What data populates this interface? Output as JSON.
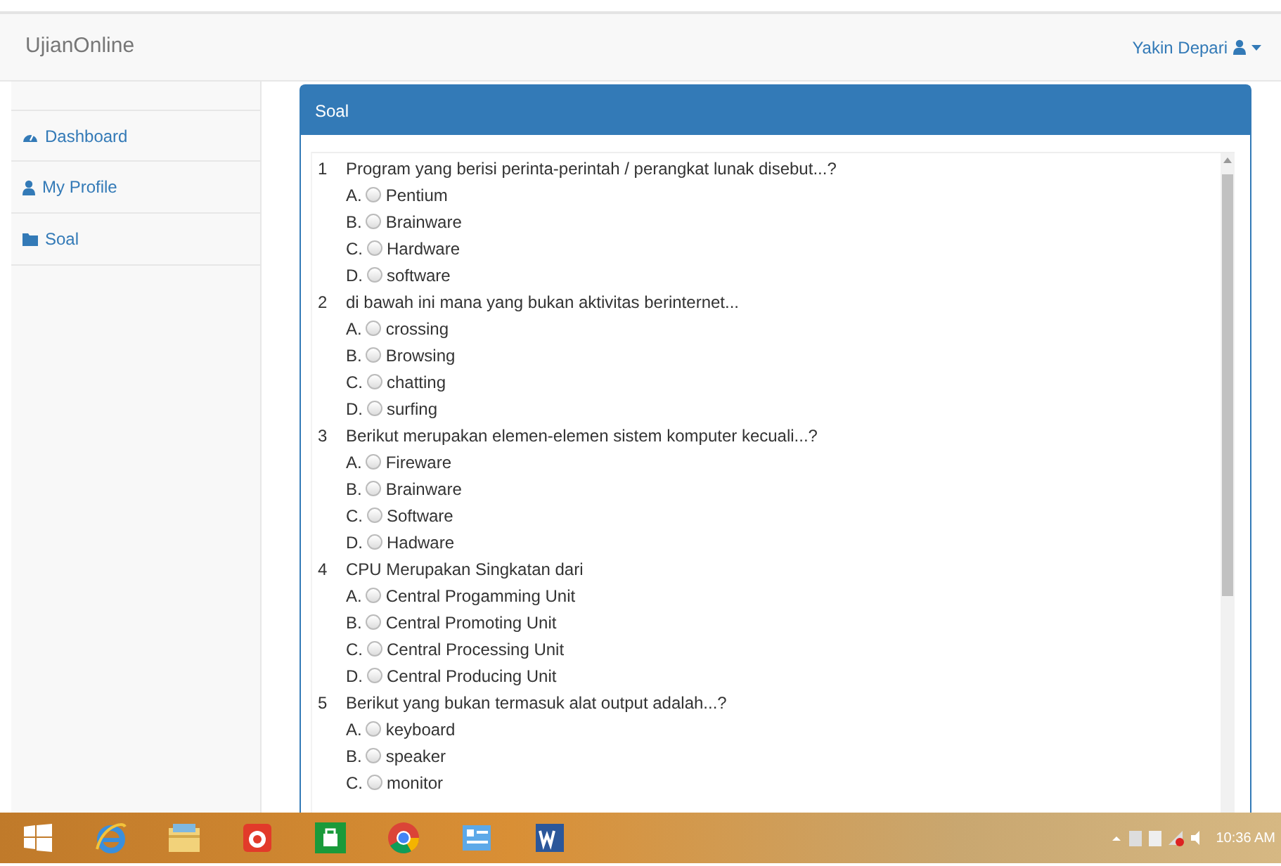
{
  "navbar": {
    "brand": "UjianOnline",
    "user": "Yakin Depari"
  },
  "sidebar": {
    "items": [
      {
        "label": "Dashboard",
        "kind": "dashboard",
        "selected": false
      },
      {
        "label": "My Profile",
        "kind": "profile",
        "selected": false
      },
      {
        "label": "Soal",
        "kind": "folder",
        "selected": false
      }
    ]
  },
  "panel": {
    "title": "Soal",
    "questions": [
      {
        "number": "1",
        "text": "Program yang berisi perinta-perintah / perangkat lunak disebut...?",
        "options": [
          {
            "letter": "A.",
            "text": "Pentium",
            "selected": false
          },
          {
            "letter": "B.",
            "text": "Brainware",
            "selected": false
          },
          {
            "letter": "C.",
            "text": "Hardware",
            "selected": false
          },
          {
            "letter": "D.",
            "text": "software",
            "selected": false
          }
        ]
      },
      {
        "number": "2",
        "text": "di bawah ini mana yang  bukan aktivitas berinternet...",
        "options": [
          {
            "letter": "A.",
            "text": "crossing",
            "selected": false
          },
          {
            "letter": "B.",
            "text": "Browsing",
            "selected": false
          },
          {
            "letter": "C.",
            "text": "chatting",
            "selected": false
          },
          {
            "letter": "D.",
            "text": "surfing",
            "selected": false
          }
        ]
      },
      {
        "number": "3",
        "text": "Berikut merupakan elemen-elemen sistem komputer kecuali...?",
        "options": [
          {
            "letter": "A.",
            "text": "Fireware",
            "selected": false
          },
          {
            "letter": "B.",
            "text": "Brainware",
            "selected": false
          },
          {
            "letter": "C.",
            "text": "Software",
            "selected": false
          },
          {
            "letter": "D.",
            "text": "Hadware",
            "selected": false
          }
        ]
      },
      {
        "number": "4",
        "text": "CPU Merupakan Singkatan dari",
        "options": [
          {
            "letter": "A.",
            "text": "Central Progamming Unit",
            "selected": false
          },
          {
            "letter": "B.",
            "text": "Central Promoting Unit",
            "selected": false
          },
          {
            "letter": "C.",
            "text": "Central Processing Unit",
            "selected": false
          },
          {
            "letter": "D.",
            "text": "Central Producing Unit",
            "selected": false
          }
        ]
      },
      {
        "number": "5",
        "text": "Berikut yang bukan termasuk alat output adalah...?",
        "options": [
          {
            "letter": "A.",
            "text": "keyboard",
            "selected": false
          },
          {
            "letter": "B.",
            "text": "speaker",
            "selected": false
          },
          {
            "letter": "C.",
            "text": "monitor",
            "selected": false
          }
        ]
      }
    ]
  },
  "taskbar": {
    "apps": [
      {
        "kind": "browser"
      },
      {
        "kind": "folder"
      },
      {
        "kind": "media"
      },
      {
        "kind": "store"
      },
      {
        "kind": "chrome"
      },
      {
        "kind": "panel"
      },
      {
        "kind": "word"
      }
    ],
    "time": "10:36 AM"
  }
}
